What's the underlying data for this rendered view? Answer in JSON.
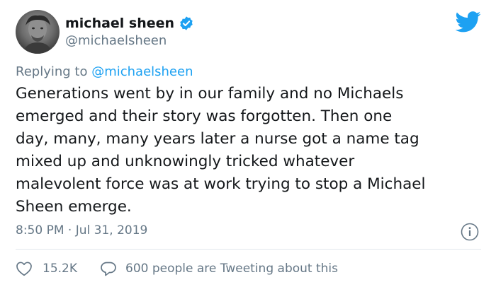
{
  "author": {
    "display_name": "michael sheen",
    "handle": "@michaelsheen",
    "verified": true,
    "avatar_icon": "profile-photo"
  },
  "reply": {
    "prefix": "Replying to ",
    "mention": "@michaelsheen"
  },
  "tweet": {
    "text": "Generations went by in our family and no Michaels\nemerged and their story was forgotten. Then one\nday, many, many years later a nurse got a name tag\nmixed up and unknowingly tricked whatever\nmalevolent force was at work trying to stop a Michael\nSheen emerge."
  },
  "meta": {
    "timestamp": "8:50 PM · Jul 31, 2019"
  },
  "engagement": {
    "likes": "15.2K",
    "tweeting": "600 people are Tweeting about this"
  },
  "icons": {
    "brand": "twitter-bird",
    "verified": "verified-badge",
    "info": "info-icon",
    "like": "heart-icon",
    "reply": "speech-bubble-icon"
  },
  "colors": {
    "brand_blue": "#1da1f2",
    "secondary_text": "#657786",
    "primary_text": "#14171a",
    "divider": "#e1e8ed"
  }
}
